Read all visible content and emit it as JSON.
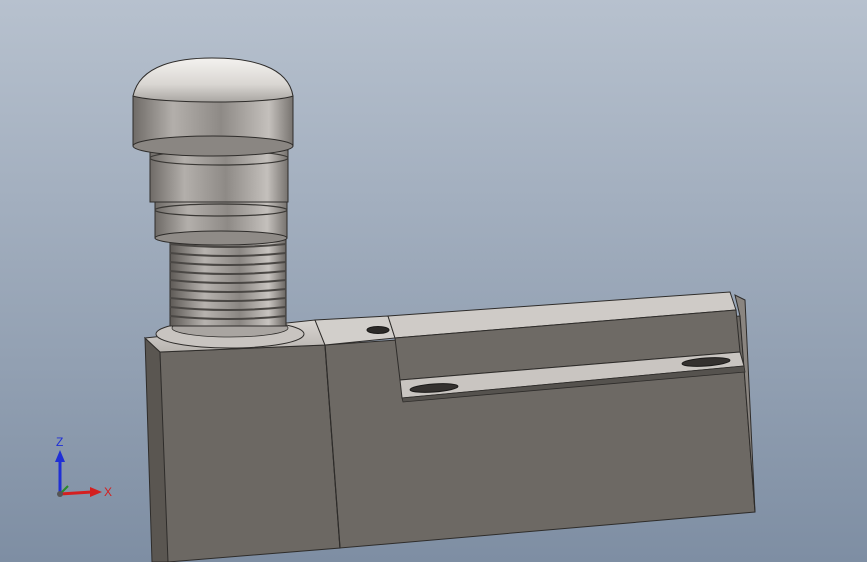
{
  "viewport": {
    "background_top": "#b7c1ce",
    "background_bottom": "#7e8ea3"
  },
  "model": {
    "body_color": "#6b6762",
    "body_dark": "#58544f",
    "body_edge": "#3a3835",
    "cap_color": "#d6d3cf",
    "cap_highlight": "#f2f0ed",
    "spring_color": "#9a9692"
  },
  "triad": {
    "z_label": "Z",
    "x_label": "X",
    "z_color": "#1f2fd6",
    "x_color": "#d41f1f",
    "y_color": "#2a8a2a"
  }
}
